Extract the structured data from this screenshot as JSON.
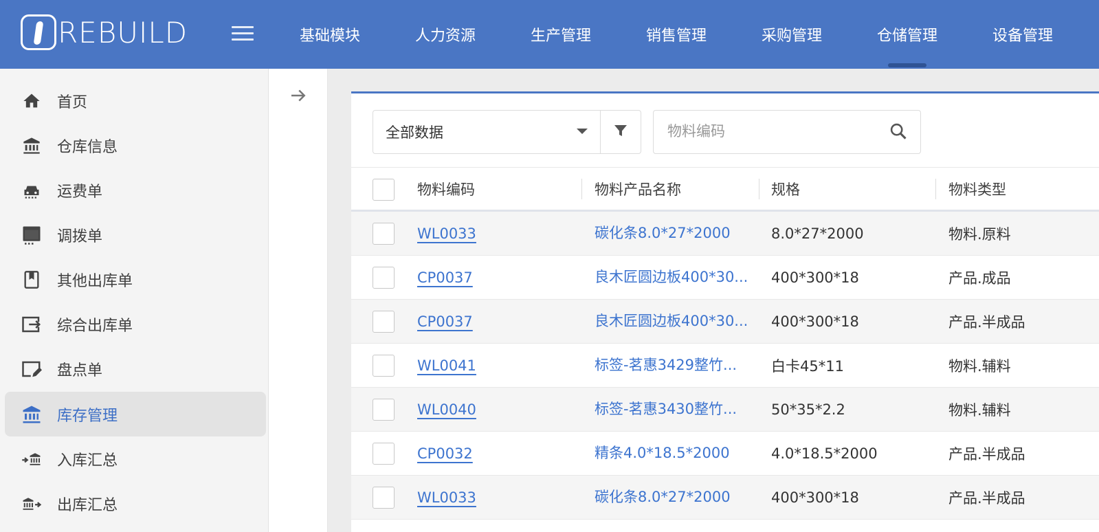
{
  "header": {
    "logo_text": "REBUILD",
    "nav": [
      {
        "label": "基础模块",
        "active": false
      },
      {
        "label": "人力资源",
        "active": false
      },
      {
        "label": "生产管理",
        "active": false
      },
      {
        "label": "销售管理",
        "active": false
      },
      {
        "label": "采购管理",
        "active": false
      },
      {
        "label": "仓储管理",
        "active": true
      },
      {
        "label": "设备管理",
        "active": false
      }
    ]
  },
  "sidebar": {
    "items": [
      {
        "label": "首页",
        "icon": "home-icon"
      },
      {
        "label": "仓库信息",
        "icon": "bank-icon"
      },
      {
        "label": "运费单",
        "icon": "car-icon"
      },
      {
        "label": "调拨单",
        "icon": "card-icon"
      },
      {
        "label": "其他出库单",
        "icon": "bookmark-icon"
      },
      {
        "label": "综合出库单",
        "icon": "export-icon"
      },
      {
        "label": "盘点单",
        "icon": "edit-icon"
      },
      {
        "label": "库存管理",
        "icon": "bank-icon",
        "active": true
      },
      {
        "label": "入库汇总",
        "icon": "bank-in-icon"
      },
      {
        "label": "出库汇总",
        "icon": "bank-out-icon"
      }
    ]
  },
  "toolbar": {
    "filter_value": "全部数据",
    "search_placeholder": "物料编码"
  },
  "table": {
    "columns": [
      "物料编码",
      "物料产品名称",
      "规格",
      "物料类型"
    ],
    "rows": [
      {
        "code": "WL0033",
        "name": "碳化条8.0*27*2000",
        "spec": "8.0*27*2000",
        "type": "物料.原料"
      },
      {
        "code": "CP0037",
        "name": "良木匠圆边板400*30...",
        "spec": "400*300*18",
        "type": "产品.成品"
      },
      {
        "code": "CP0037",
        "name": "良木匠圆边板400*30...",
        "spec": "400*300*18",
        "type": "产品.半成品"
      },
      {
        "code": "WL0041",
        "name": "标签-茗惠3429整竹...",
        "spec": "白卡45*11",
        "type": "物料.辅料"
      },
      {
        "code": "WL0040",
        "name": "标签-茗惠3430整竹...",
        "spec": "50*35*2.2",
        "type": "物料.辅料"
      },
      {
        "code": "CP0032",
        "name": "精条4.0*18.5*2000",
        "spec": "4.0*18.5*2000",
        "type": "产品.半成品"
      },
      {
        "code": "WL0033",
        "name": "碳化条8.0*27*2000",
        "spec": "400*300*18",
        "type": "产品.半成品"
      }
    ]
  },
  "colors": {
    "brand": "#4a76c4",
    "link": "#3d74cf",
    "active_nav_indicator": "#2f5394"
  }
}
